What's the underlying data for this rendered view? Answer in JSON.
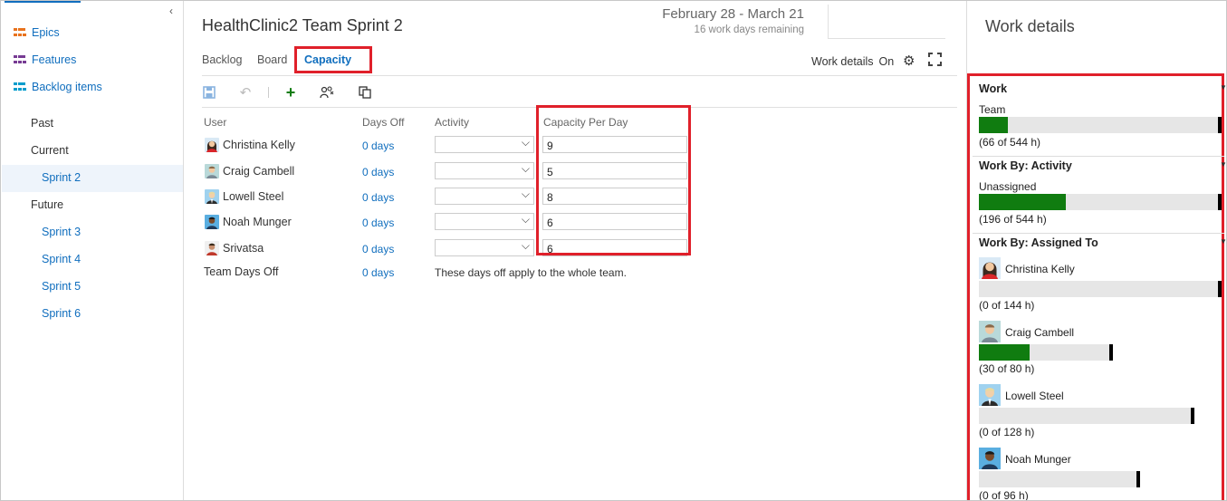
{
  "sidebar": {
    "collapse_icon": "chevron-left-icon",
    "backlog_levels": [
      {
        "label": "Epics",
        "icon": "epic-icon",
        "color": "#e8731e"
      },
      {
        "label": "Features",
        "icon": "feature-icon",
        "color": "#773b93"
      },
      {
        "label": "Backlog items",
        "icon": "backlog-item-icon",
        "color": "#009ccc"
      }
    ],
    "past_label": "Past",
    "current_label": "Current",
    "current_sprint": "Sprint 2",
    "future_label": "Future",
    "future_sprints": [
      "Sprint 3",
      "Sprint 4",
      "Sprint 5",
      "Sprint 6"
    ]
  },
  "header": {
    "title": "HealthClinic2 Team Sprint 2",
    "date_range": "February 28 - March 21",
    "remaining": "16 work days remaining"
  },
  "tabs": {
    "backlog": "Backlog",
    "board": "Board",
    "capacity": "Capacity",
    "active": "Capacity"
  },
  "work_details_toggle": {
    "label": "Work details",
    "state": "On"
  },
  "toolbar": {
    "icons": [
      "save-icon",
      "undo-icon",
      "add-icon",
      "add-missing-members-icon",
      "copy-icon"
    ]
  },
  "capacity": {
    "columns": {
      "user": "User",
      "days_off": "Days Off",
      "activity": "Activity",
      "capacity_per_day": "Capacity Per Day"
    },
    "rows": [
      {
        "user": "Christina Kelly",
        "days_off": "0 days",
        "activity": "",
        "capacity": "9"
      },
      {
        "user": "Craig Cambell",
        "days_off": "0 days",
        "activity": "",
        "capacity": "5"
      },
      {
        "user": "Lowell Steel",
        "days_off": "0 days",
        "activity": "",
        "capacity": "8"
      },
      {
        "user": "Noah Munger",
        "days_off": "0 days",
        "activity": "",
        "capacity": "6"
      },
      {
        "user": "Srivatsa",
        "days_off": "0 days",
        "activity": "",
        "capacity": "6"
      }
    ],
    "team_days_off": {
      "label": "Team Days Off",
      "days_off": "0 days",
      "note": "These days off apply to the whole team."
    }
  },
  "work_details": {
    "title": "Work details",
    "work": {
      "title": "Work",
      "label": "Team",
      "summary": "(66 of 544 h)",
      "fill": 0.12
    },
    "by_activity": {
      "title": "Work By: Activity",
      "label": "Unassigned",
      "summary": "(196 of 544 h)",
      "fill": 0.36
    },
    "by_assigned": {
      "title": "Work By: Assigned To",
      "people": [
        {
          "name": "Christina Kelly",
          "summary": "(0 of 144 h)",
          "fill": 0.0,
          "capacity": 1.0
        },
        {
          "name": "Craig Cambell",
          "summary": "(30 of 80 h)",
          "fill": 0.375,
          "capacity": 1.0
        },
        {
          "name": "Lowell Steel",
          "summary": "(0 of 128 h)",
          "fill": 0.0,
          "capacity": 1.0
        },
        {
          "name": "Noah Munger",
          "summary": "(0 of 96 h)",
          "fill": 0.0,
          "capacity": 1.0
        }
      ]
    }
  },
  "colors": {
    "accent": "#106ebe",
    "bar_fill": "#107c10",
    "highlight": "#e0202a"
  }
}
